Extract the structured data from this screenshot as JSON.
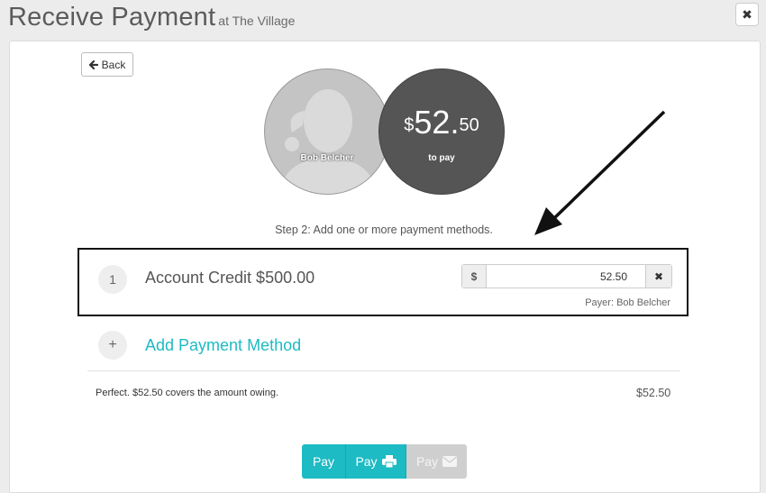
{
  "header": {
    "title": "Receive Payment",
    "subtitle": "at The Village",
    "close_icon": "✖"
  },
  "back_button": {
    "label": "Back",
    "icon": "arrow-left-icon"
  },
  "customer": {
    "name": "Bob Belcher"
  },
  "amount_due": {
    "currency": "$",
    "dollars": "52.",
    "cents": "50",
    "label": "to pay"
  },
  "step_text": "Step 2: Add one or more payment methods.",
  "payment_methods": [
    {
      "number": "1",
      "name": "Account Credit $500.00",
      "currency": "$",
      "amount": "52.50",
      "remove_icon": "✖",
      "payer": "Payer: Bob Belcher"
    }
  ],
  "add_method": {
    "icon": "+",
    "label": "Add Payment Method"
  },
  "summary": {
    "text": "Perfect. $52.50 covers the amount owing.",
    "amount": "$52.50"
  },
  "pay_buttons": [
    {
      "label": "Pay",
      "icon": ""
    },
    {
      "label": "Pay",
      "icon": "printer-icon"
    },
    {
      "label": "Pay",
      "icon": "envelope-icon"
    }
  ],
  "colors": {
    "accent": "#1dbbc4",
    "amount_circle": "#555555",
    "disabled": "#cfcfcf",
    "annotation": "#111111"
  }
}
